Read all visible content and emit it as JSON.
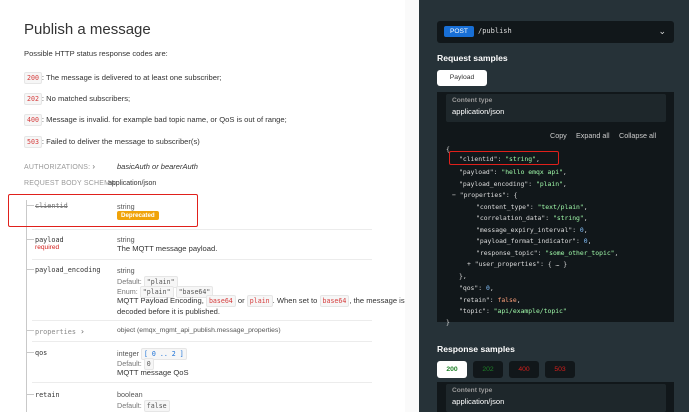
{
  "left": {
    "title": "Publish a message",
    "intro": "Possible HTTP status response codes are:",
    "responses": [
      {
        "code": "200",
        "text": ": The message is delivered to at least one subscriber;"
      },
      {
        "code": "202",
        "text": ": No matched subscribers;"
      },
      {
        "code": "400",
        "text": ": Message is invalid. for example bad topic name, or QoS is out of range;"
      },
      {
        "code": "503",
        "text": ": Failed to deliver the message to subscriber(s)"
      }
    ],
    "auth_label": "AUTHORIZATIONS:",
    "auth_value": "basicAuth or bearerAuth",
    "schema_label": "REQUEST BODY SCHEMA:",
    "schema_value": "application/json",
    "params": {
      "clientid": {
        "name": "clientid",
        "type": "string",
        "badge": "Deprecated"
      },
      "payload": {
        "name": "payload",
        "required": "required",
        "type": "string",
        "desc": "The MQTT message payload."
      },
      "payload_encoding": {
        "name": "payload_encoding",
        "type": "string",
        "default_label": "Default:",
        "default_value": "\"plain\"",
        "enum_label": "Enum:",
        "enum_values": [
          "\"plain\"",
          "\"base64\""
        ],
        "desc_a": "MQTT Payload Encoding,",
        "code_a": "base64",
        "desc_b": "or",
        "code_b": "plain",
        "desc_c": ". When set to",
        "code_c": "base64",
        "desc_d": ", the message is",
        "desc_e": "decoded before it is published."
      },
      "properties": {
        "name": "properties",
        "type": "object (emqx_mgmt_api_publish.message_properties)"
      },
      "qos": {
        "name": "qos",
        "type": "integer",
        "range": "[ 0 .. 2 ]",
        "default_label": "Default:",
        "default_value": "0",
        "desc": "MQTT message QoS"
      },
      "retain": {
        "name": "retain",
        "type": "boolean",
        "default_label": "Default:",
        "default_value": "false"
      }
    }
  },
  "right": {
    "method": "POST",
    "path": "/publish",
    "request_title": "Request samples",
    "payload_tab": "Payload",
    "content_type_label": "Content type",
    "content_type_value": "application/json",
    "copy": "Copy",
    "expand_all": "Expand all",
    "collapse_all": "Collapse all",
    "json": {
      "open": "{",
      "clientid_k": "\"clientid\"",
      "clientid_v": "\"string\"",
      "payload_k": "\"payload\"",
      "payload_v": "\"hello emqx api\"",
      "enc_k": "\"payload_encoding\"",
      "enc_v": "\"plain\"",
      "toggle": "−",
      "props_k": "\"properties\"",
      "props_open": "{",
      "ct_k": "\"content_type\"",
      "ct_v": "\"text/plain\"",
      "cd_k": "\"correlation_data\"",
      "cd_v": "\"string\"",
      "mei_k": "\"message_expiry_interval\"",
      "mei_v": "0",
      "pfi_k": "\"payload_format_indicator\"",
      "pfi_v": "0",
      "rt_k": "\"response_topic\"",
      "rt_v": "\"some_other_topic\"",
      "plus": "+",
      "up_k": "\"user_properties\"",
      "up_v": "{ … }",
      "props_close": "},",
      "qos_k": "\"qos\"",
      "qos_v": "0",
      "retain_k": "\"retain\"",
      "retain_v": "false",
      "topic_k": "\"topic\"",
      "topic_v": "\"api/example/topic\"",
      "close": "}"
    },
    "response_title": "Response samples",
    "response_tabs": [
      "200",
      "202",
      "400",
      "503"
    ],
    "response_ct_label": "Content type",
    "response_ct_value": "application/json"
  },
  "colors": {
    "tab_200": "#1d8127",
    "tab_202": "#1d8127",
    "tab_400": "#d41f1c",
    "tab_503": "#d41f1c",
    "highlight_box": "#e0201b",
    "deprecated": "#f0a30a"
  }
}
